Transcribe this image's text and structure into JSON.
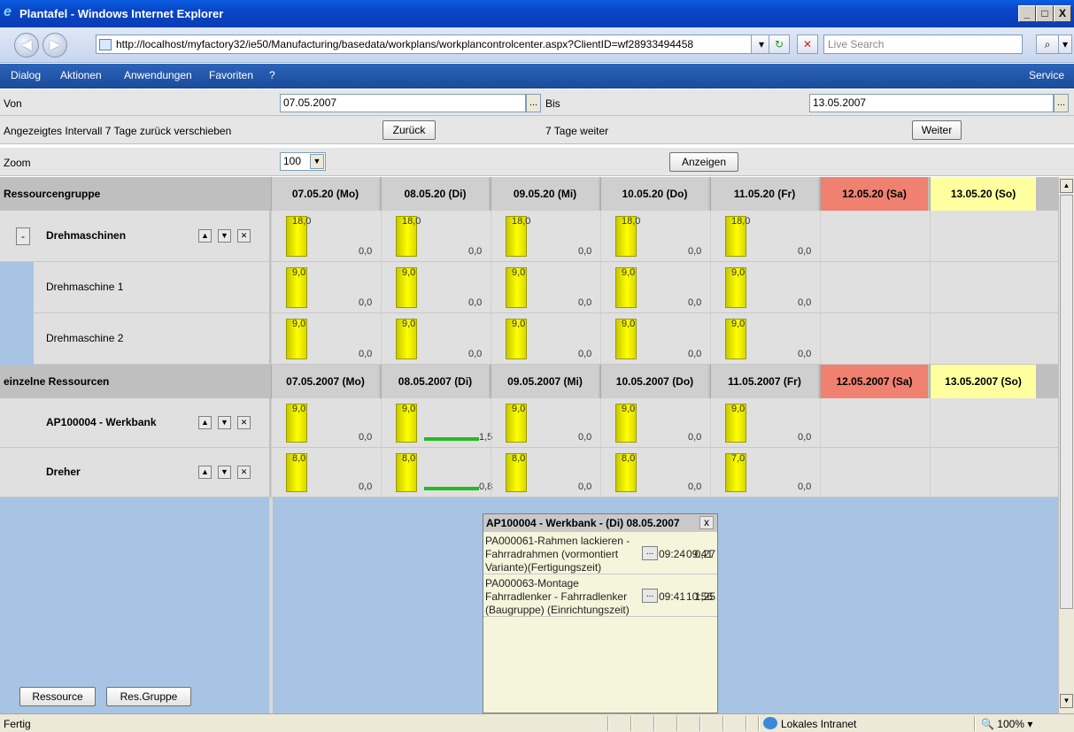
{
  "window": {
    "title": "Plantafel - Windows Internet Explorer",
    "min": "_",
    "max": "□",
    "close": "X"
  },
  "address": {
    "url": "http://localhost/myfactory32/ie50/Manufacturing/basedata/workplans/workplancontrolcenter.aspx?ClientID=wf28933494458",
    "search_placeholder": "Live Search",
    "back": "◀",
    "forward": "▶",
    "refresh": "↻",
    "stop": "✕",
    "search_btn": "⌕"
  },
  "menu": {
    "items": [
      "Dialog",
      "Aktionen",
      "Anwendungen",
      "Favoriten",
      "?"
    ],
    "right": "Service"
  },
  "filter": {
    "von_label": "Von",
    "von_value": "07.05.2007",
    "bis_label": "Bis",
    "bis_value": "13.05.2007",
    "dots": "...",
    "back_text": "Angezeigtes Intervall 7 Tage zurück verschieben",
    "back_btn": "Zurück",
    "fwd_text": "7 Tage weiter",
    "fwd_btn": "Weiter",
    "zoom_label": "Zoom",
    "zoom_value": "100",
    "show_btn": "Anzeigen"
  },
  "group_section": {
    "header": "Ressourcengruppe",
    "days": [
      "07.05.20 (Mo)",
      "08.05.20 (Di)",
      "09.05.20 (Mi)",
      "10.05.20 (Do)",
      "11.05.20 (Fr)",
      "12.05.20 (Sa)",
      "13.05.20 (So)"
    ],
    "collapse": "-",
    "rows": [
      {
        "name": "Drehmaschinen",
        "values": [
          "18,0",
          "18,0",
          "18,0",
          "18,0",
          "18,0"
        ],
        "zeros": [
          "0,0",
          "0,0",
          "0,0",
          "0,0",
          "0,0"
        ]
      },
      {
        "name": "Drehmaschine 1",
        "values": [
          "9,0",
          "9,0",
          "9,0",
          "9,0",
          "9,0"
        ],
        "zeros": [
          "0,0",
          "0,0",
          "0,0",
          "0,0",
          "0,0"
        ]
      },
      {
        "name": "Drehmaschine 2",
        "values": [
          "9,0",
          "9,0",
          "9,0",
          "9,0",
          "9,0"
        ],
        "zeros": [
          "0,0",
          "0,0",
          "0,0",
          "0,0",
          "0,0"
        ]
      }
    ]
  },
  "single_section": {
    "header": "einzelne Ressourcen",
    "days": [
      "07.05.2007 (Mo)",
      "08.05.2007 (Di)",
      "09.05.2007 (Mi)",
      "10.05.2007 (Do)",
      "11.05.2007 (Fr)",
      "12.05.2007 (Sa)",
      "13.05.2007 (So)"
    ],
    "rows": [
      {
        "name": "AP100004 - Werkbank",
        "values": [
          "9,0",
          "9,0",
          "9,0",
          "9,0",
          "9,0"
        ],
        "zeros": [
          "0,0",
          "1,5",
          "0,0",
          "0,0",
          "0,0"
        ]
      },
      {
        "name": "Dreher",
        "values": [
          "8,0",
          "8,0",
          "8,0",
          "8,0",
          "7,0"
        ],
        "zeros": [
          "0,0",
          "0,8",
          "0,0",
          "0,0",
          "0,0"
        ]
      }
    ]
  },
  "row_icons": {
    "up": "▲",
    "down": "▼",
    "del": "✕"
  },
  "bottom_buttons": {
    "resource": "Ressource",
    "group": "Res.Gruppe"
  },
  "popup": {
    "title": "AP100004 - Werkbank - (Di) 08.05.2007",
    "close": "x",
    "entries": [
      {
        "lines": [
          "PA000061-Rahmen lackieren -",
          "Fahrradrahmen (vormontiert",
          "Variante)(Fertigungszeit)"
        ],
        "start": "09:24",
        "end": "09:41",
        "dur": "0,27"
      },
      {
        "lines": [
          "PA000063-Montage",
          "Fahrradlenker - Fahrradlenker",
          "(Baugruppe) (Einrichtungszeit)"
        ],
        "start": "09:41",
        "end": "10:56",
        "dur": "1,25"
      }
    ]
  },
  "status": {
    "text": "Fertig",
    "zone": "Lokales Intranet",
    "zoom": "100%"
  },
  "colors": {
    "sat": "#f08070",
    "sun": "#ffffa0",
    "bar": "#ffff00",
    "panel": "#a8c4e4"
  }
}
